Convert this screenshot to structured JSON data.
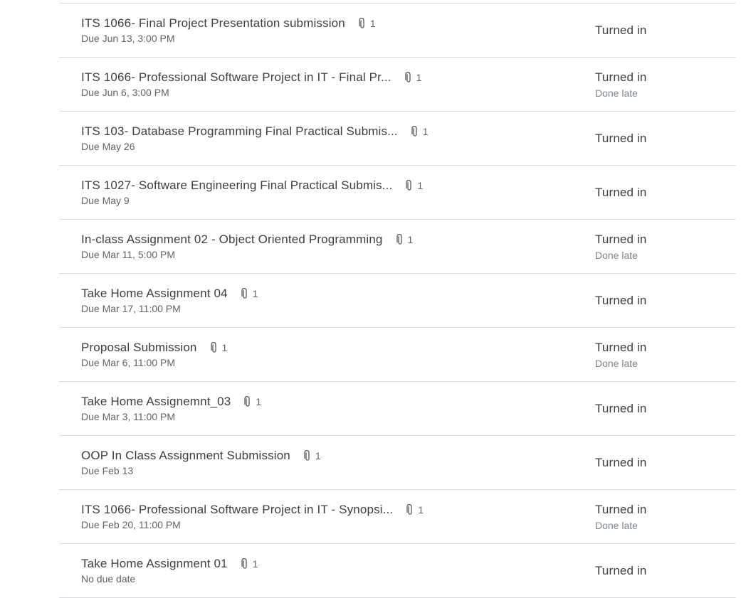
{
  "assignments": [
    {
      "title": "ITS 1066- Final Project Presentation submission",
      "attachments": "1",
      "due": "Due Jun 13, 3:00 PM",
      "status": "Turned in",
      "late": ""
    },
    {
      "title": "ITS 1066- Professional Software Project in IT - Final Pr...",
      "attachments": "1",
      "due": "Due Jun 6, 3:00 PM",
      "status": "Turned in",
      "late": "Done late"
    },
    {
      "title": "ITS 103- Database Programming Final Practical Submis...",
      "attachments": "1",
      "due": "Due May 26",
      "status": "Turned in",
      "late": ""
    },
    {
      "title": "ITS 1027- Software Engineering Final Practical Submis...",
      "attachments": "1",
      "due": "Due May 9",
      "status": "Turned in",
      "late": ""
    },
    {
      "title": "In-class Assignment 02 - Object Oriented Programming",
      "attachments": "1",
      "due": "Due Mar 11, 5:00 PM",
      "status": "Turned in",
      "late": "Done late"
    },
    {
      "title": "Take Home Assignment 04",
      "attachments": "1",
      "due": "Due Mar 17, 11:00 PM",
      "status": "Turned in",
      "late": ""
    },
    {
      "title": "Proposal Submission",
      "attachments": "1",
      "due": "Due Mar 6, 11:00 PM",
      "status": "Turned in",
      "late": "Done late"
    },
    {
      "title": "Take Home Assignemnt_03",
      "attachments": "1",
      "due": "Due Mar 3, 11:00 PM",
      "status": "Turned in",
      "late": ""
    },
    {
      "title": "OOP In Class Assignment Submission",
      "attachments": "1",
      "due": "Due Feb 13",
      "status": "Turned in",
      "late": ""
    },
    {
      "title": "ITS 1066- Professional Software Project in IT - Synopsi...",
      "attachments": "1",
      "due": "Due Feb 20, 11:00 PM",
      "status": "Turned in",
      "late": "Done late"
    },
    {
      "title": "Take Home Assignment 01",
      "attachments": "1",
      "due": "No due date",
      "status": "Turned in",
      "late": ""
    }
  ],
  "icons": {
    "attachment": "paperclip-icon"
  },
  "colors": {
    "text": "#3c4043",
    "secondary": "#5f6368",
    "muted": "#80868b",
    "divider": "#dadce0"
  }
}
